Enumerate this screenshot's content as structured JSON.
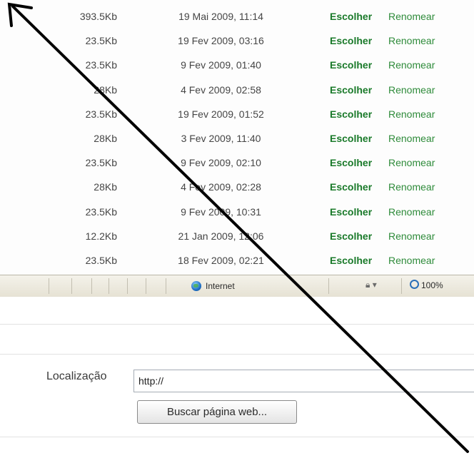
{
  "files": [
    {
      "size": "393.5Kb",
      "date": "19 Mai 2009, 11:14",
      "choose": "Escolher",
      "rename": "Renomear"
    },
    {
      "size": "23.5Kb",
      "date": "19 Fev 2009, 03:16",
      "choose": "Escolher",
      "rename": "Renomear"
    },
    {
      "size": "23.5Kb",
      "date": "9 Fev 2009, 01:40",
      "choose": "Escolher",
      "rename": "Renomear"
    },
    {
      "size": "28Kb",
      "date": "4 Fev 2009, 02:58",
      "choose": "Escolher",
      "rename": "Renomear"
    },
    {
      "size": "23.5Kb",
      "date": "19 Fev 2009, 01:52",
      "choose": "Escolher",
      "rename": "Renomear"
    },
    {
      "size": "28Kb",
      "date": "3 Fev 2009, 11:40",
      "choose": "Escolher",
      "rename": "Renomear"
    },
    {
      "size": "23.5Kb",
      "date": "9 Fev 2009, 02:10",
      "choose": "Escolher",
      "rename": "Renomear"
    },
    {
      "size": "28Kb",
      "date": "4 Fev 2009, 02:28",
      "choose": "Escolher",
      "rename": "Renomear"
    },
    {
      "size": "23.5Kb",
      "date": "9 Fev 2009, 10:31",
      "choose": "Escolher",
      "rename": "Renomear"
    },
    {
      "size": "12.2Kb",
      "date": "21 Jan 2009, 12:06",
      "choose": "Escolher",
      "rename": "Renomear"
    },
    {
      "size": "23.5Kb",
      "date": "18 Fev 2009, 02:21",
      "choose": "Escolher",
      "rename": "Renomear"
    }
  ],
  "statusbar": {
    "zone_label": "Internet",
    "zone_icon": "globe-icon",
    "protected_mode_icon": "lock-icon",
    "zoom_label": "100%",
    "zoom_icon": "magnifier-icon"
  },
  "form": {
    "location_label": "Localização",
    "url_value": "http://",
    "fetch_button": "Buscar página web..."
  },
  "colors": {
    "choose_link": "#1a7a2a",
    "rename_link": "#2e8b3a",
    "statusbar_bg": "#ece9d8",
    "annotation_arrow": "#000000"
  }
}
